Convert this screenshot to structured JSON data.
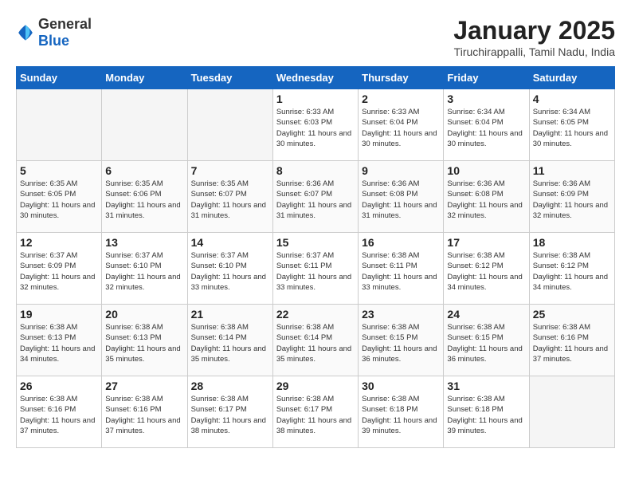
{
  "header": {
    "logo_general": "General",
    "logo_blue": "Blue",
    "title": "January 2025",
    "subtitle": "Tiruchirappalli, Tamil Nadu, India"
  },
  "days_of_week": [
    "Sunday",
    "Monday",
    "Tuesday",
    "Wednesday",
    "Thursday",
    "Friday",
    "Saturday"
  ],
  "weeks": [
    [
      {
        "day": "",
        "empty": true
      },
      {
        "day": "",
        "empty": true
      },
      {
        "day": "",
        "empty": true
      },
      {
        "day": "1",
        "sunrise": "Sunrise: 6:33 AM",
        "sunset": "Sunset: 6:03 PM",
        "daylight": "Daylight: 11 hours and 30 minutes."
      },
      {
        "day": "2",
        "sunrise": "Sunrise: 6:33 AM",
        "sunset": "Sunset: 6:04 PM",
        "daylight": "Daylight: 11 hours and 30 minutes."
      },
      {
        "day": "3",
        "sunrise": "Sunrise: 6:34 AM",
        "sunset": "Sunset: 6:04 PM",
        "daylight": "Daylight: 11 hours and 30 minutes."
      },
      {
        "day": "4",
        "sunrise": "Sunrise: 6:34 AM",
        "sunset": "Sunset: 6:05 PM",
        "daylight": "Daylight: 11 hours and 30 minutes."
      }
    ],
    [
      {
        "day": "5",
        "sunrise": "Sunrise: 6:35 AM",
        "sunset": "Sunset: 6:05 PM",
        "daylight": "Daylight: 11 hours and 30 minutes."
      },
      {
        "day": "6",
        "sunrise": "Sunrise: 6:35 AM",
        "sunset": "Sunset: 6:06 PM",
        "daylight": "Daylight: 11 hours and 31 minutes."
      },
      {
        "day": "7",
        "sunrise": "Sunrise: 6:35 AM",
        "sunset": "Sunset: 6:07 PM",
        "daylight": "Daylight: 11 hours and 31 minutes."
      },
      {
        "day": "8",
        "sunrise": "Sunrise: 6:36 AM",
        "sunset": "Sunset: 6:07 PM",
        "daylight": "Daylight: 11 hours and 31 minutes."
      },
      {
        "day": "9",
        "sunrise": "Sunrise: 6:36 AM",
        "sunset": "Sunset: 6:08 PM",
        "daylight": "Daylight: 11 hours and 31 minutes."
      },
      {
        "day": "10",
        "sunrise": "Sunrise: 6:36 AM",
        "sunset": "Sunset: 6:08 PM",
        "daylight": "Daylight: 11 hours and 32 minutes."
      },
      {
        "day": "11",
        "sunrise": "Sunrise: 6:36 AM",
        "sunset": "Sunset: 6:09 PM",
        "daylight": "Daylight: 11 hours and 32 minutes."
      }
    ],
    [
      {
        "day": "12",
        "sunrise": "Sunrise: 6:37 AM",
        "sunset": "Sunset: 6:09 PM",
        "daylight": "Daylight: 11 hours and 32 minutes."
      },
      {
        "day": "13",
        "sunrise": "Sunrise: 6:37 AM",
        "sunset": "Sunset: 6:10 PM",
        "daylight": "Daylight: 11 hours and 32 minutes."
      },
      {
        "day": "14",
        "sunrise": "Sunrise: 6:37 AM",
        "sunset": "Sunset: 6:10 PM",
        "daylight": "Daylight: 11 hours and 33 minutes."
      },
      {
        "day": "15",
        "sunrise": "Sunrise: 6:37 AM",
        "sunset": "Sunset: 6:11 PM",
        "daylight": "Daylight: 11 hours and 33 minutes."
      },
      {
        "day": "16",
        "sunrise": "Sunrise: 6:38 AM",
        "sunset": "Sunset: 6:11 PM",
        "daylight": "Daylight: 11 hours and 33 minutes."
      },
      {
        "day": "17",
        "sunrise": "Sunrise: 6:38 AM",
        "sunset": "Sunset: 6:12 PM",
        "daylight": "Daylight: 11 hours and 34 minutes."
      },
      {
        "day": "18",
        "sunrise": "Sunrise: 6:38 AM",
        "sunset": "Sunset: 6:12 PM",
        "daylight": "Daylight: 11 hours and 34 minutes."
      }
    ],
    [
      {
        "day": "19",
        "sunrise": "Sunrise: 6:38 AM",
        "sunset": "Sunset: 6:13 PM",
        "daylight": "Daylight: 11 hours and 34 minutes."
      },
      {
        "day": "20",
        "sunrise": "Sunrise: 6:38 AM",
        "sunset": "Sunset: 6:13 PM",
        "daylight": "Daylight: 11 hours and 35 minutes."
      },
      {
        "day": "21",
        "sunrise": "Sunrise: 6:38 AM",
        "sunset": "Sunset: 6:14 PM",
        "daylight": "Daylight: 11 hours and 35 minutes."
      },
      {
        "day": "22",
        "sunrise": "Sunrise: 6:38 AM",
        "sunset": "Sunset: 6:14 PM",
        "daylight": "Daylight: 11 hours and 35 minutes."
      },
      {
        "day": "23",
        "sunrise": "Sunrise: 6:38 AM",
        "sunset": "Sunset: 6:15 PM",
        "daylight": "Daylight: 11 hours and 36 minutes."
      },
      {
        "day": "24",
        "sunrise": "Sunrise: 6:38 AM",
        "sunset": "Sunset: 6:15 PM",
        "daylight": "Daylight: 11 hours and 36 minutes."
      },
      {
        "day": "25",
        "sunrise": "Sunrise: 6:38 AM",
        "sunset": "Sunset: 6:16 PM",
        "daylight": "Daylight: 11 hours and 37 minutes."
      }
    ],
    [
      {
        "day": "26",
        "sunrise": "Sunrise: 6:38 AM",
        "sunset": "Sunset: 6:16 PM",
        "daylight": "Daylight: 11 hours and 37 minutes."
      },
      {
        "day": "27",
        "sunrise": "Sunrise: 6:38 AM",
        "sunset": "Sunset: 6:16 PM",
        "daylight": "Daylight: 11 hours and 37 minutes."
      },
      {
        "day": "28",
        "sunrise": "Sunrise: 6:38 AM",
        "sunset": "Sunset: 6:17 PM",
        "daylight": "Daylight: 11 hours and 38 minutes."
      },
      {
        "day": "29",
        "sunrise": "Sunrise: 6:38 AM",
        "sunset": "Sunset: 6:17 PM",
        "daylight": "Daylight: 11 hours and 38 minutes."
      },
      {
        "day": "30",
        "sunrise": "Sunrise: 6:38 AM",
        "sunset": "Sunset: 6:18 PM",
        "daylight": "Daylight: 11 hours and 39 minutes."
      },
      {
        "day": "31",
        "sunrise": "Sunrise: 6:38 AM",
        "sunset": "Sunset: 6:18 PM",
        "daylight": "Daylight: 11 hours and 39 minutes."
      },
      {
        "day": "",
        "empty": true
      }
    ]
  ]
}
